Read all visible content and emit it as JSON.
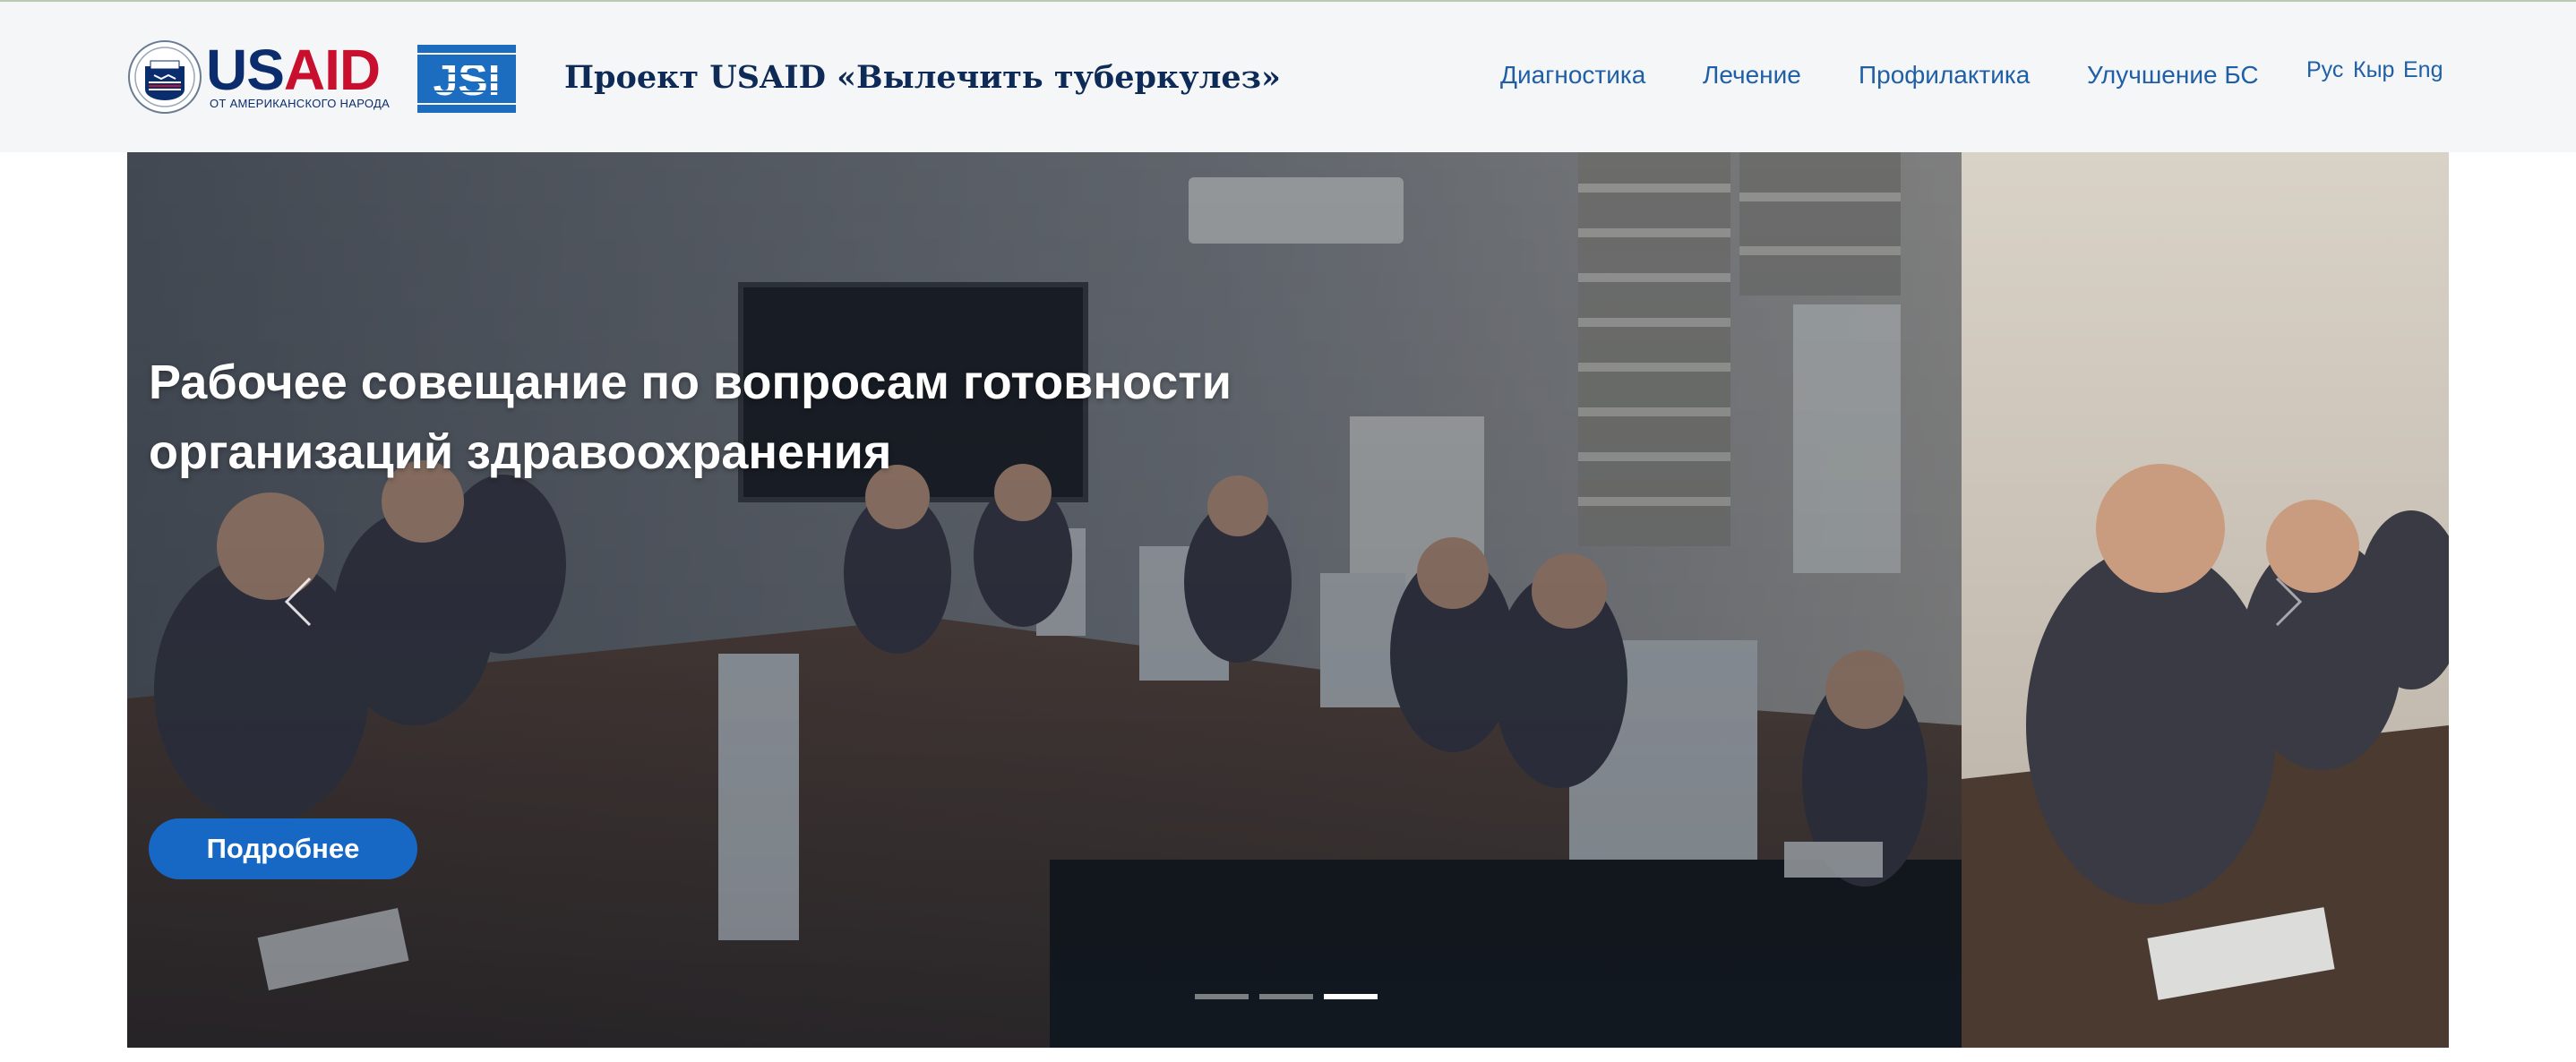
{
  "header": {
    "usaid_logo": {
      "word_us": "US",
      "word_aid": "AID",
      "tagline": "ОТ АМЕРИКАНСКОГО НАРОДА"
    },
    "jsi_logo": {
      "text": "JSI"
    },
    "project_title": "Проект USAID «Вылечить туберкулез»",
    "nav": [
      {
        "label": "Диагностика"
      },
      {
        "label": "Лечение"
      },
      {
        "label": "Профилактика"
      },
      {
        "label": "Улучшение БС"
      }
    ],
    "languages": [
      {
        "label": "Рус"
      },
      {
        "label": "Кыр"
      },
      {
        "label": "Eng"
      }
    ]
  },
  "hero": {
    "title": "Рабочее совещание по вопросам готовности организаций здравоохранения",
    "button_label": "Подробнее",
    "slides_total": 3,
    "active_slide": 3,
    "prev_icon": "chevron-left-icon",
    "next_icon": "chevron-right-icon"
  },
  "colors": {
    "header_bg": "#f5f6f8",
    "nav_link": "#1f5fa6",
    "title_dark": "#0e2a57",
    "button_bg": "#1768c4",
    "usaid_blue": "#0b2d6e",
    "usaid_red": "#c8102e"
  }
}
